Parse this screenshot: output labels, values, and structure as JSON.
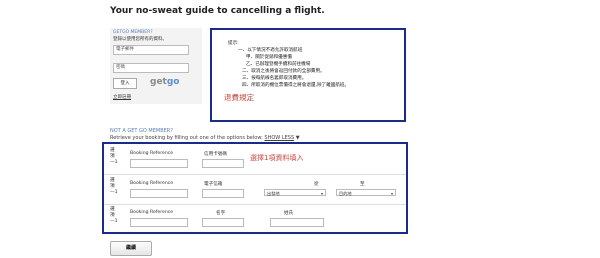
{
  "title": "Your no-sweat guide to cancelling a flight.",
  "login": {
    "heading": "GETGO MEMBER?",
    "subheading": "登錄以使用您所有的資料。",
    "email_placeholder": "電子郵件",
    "password_placeholder": "密碼",
    "login_button": "登入",
    "logo_get": "get",
    "logo_go": "go",
    "register_link": "立即註冊"
  },
  "notice": {
    "heading": "提示:",
    "lines": [
      "一、以下情況不適允許取消航班",
      "甲、關於促銷和優惠價",
      "乙、已辦理登機手續和前往機場",
      "二、取消之後將會返回付款的全部費用。",
      "三、按每航線名義即取消費用。",
      "四、所取消的機位票價得之將會退還,除了離國航班。"
    ],
    "annotation": "退費規定"
  },
  "not_member": {
    "heading": "NOT A GET GO MEMBER?",
    "retrieve_text": "Retrieve your booking by filling out one of the options below:",
    "show_less": "SHOW LESS",
    "show_less_arrow": "▼"
  },
  "options": {
    "annotation": "選擇1項資料填入",
    "rows": [
      {
        "label": "選項—1",
        "booking_ref_label": "Booking Reference",
        "second_label": "信用卡號碼"
      },
      {
        "label": "選項—1",
        "booking_ref_label": "Booking Reference",
        "second_label": "電子信箱",
        "from_label": "從",
        "to_label": "至",
        "from_value": "出發地",
        "to_value": "目的地"
      },
      {
        "label": "選項—1",
        "booking_ref_label": "Booking Reference",
        "first_name_label": "名字",
        "last_name_label": "姓氏"
      }
    ]
  },
  "confirm_button": "繼續",
  "colors": {
    "box_border": "#1c2a8a",
    "annotation_red": "#c8453a",
    "link_blue": "#5a7fb0"
  }
}
